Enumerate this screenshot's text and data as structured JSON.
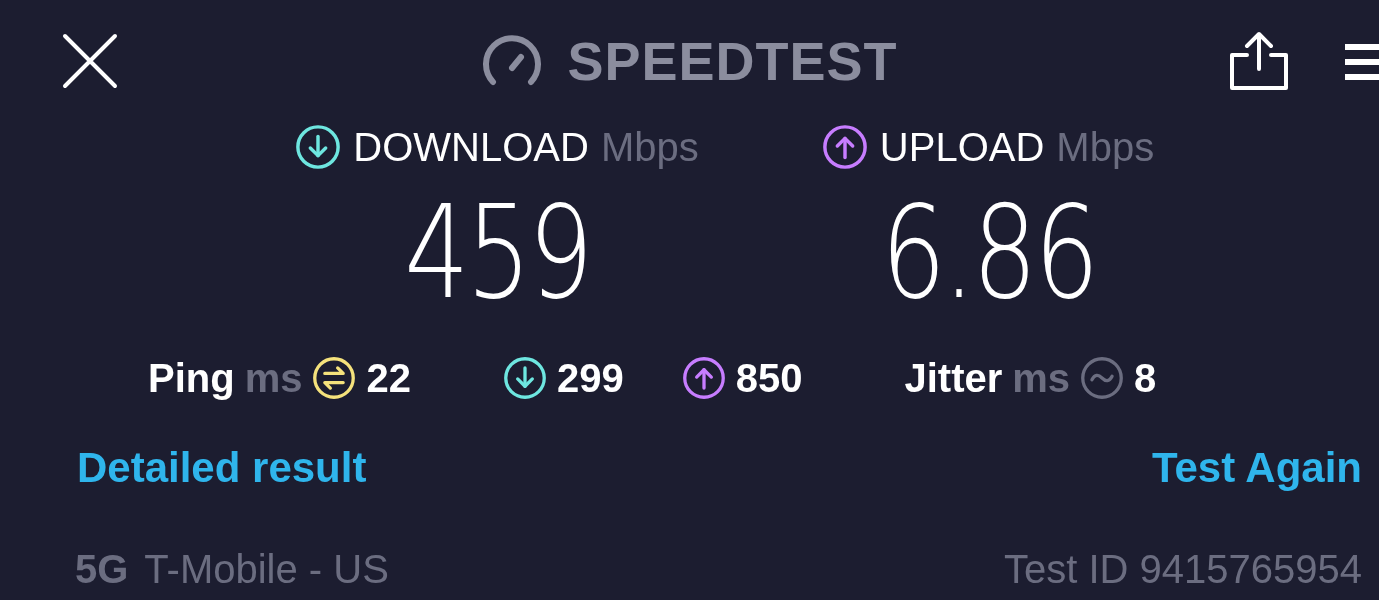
{
  "header": {
    "title": "SPEEDTEST"
  },
  "results": [
    {
      "kind": "download",
      "label": "DOWNLOAD",
      "unit": "Mbps",
      "value": "459",
      "color": "#6ee6e0"
    },
    {
      "kind": "upload",
      "label": "UPLOAD",
      "unit": "Mbps",
      "value": "6.86",
      "color": "#c77dff"
    }
  ],
  "stats": [
    {
      "kind": "ping",
      "label": "Ping",
      "unit": "ms",
      "value": "22",
      "color": "#f5e27c"
    },
    {
      "kind": "download",
      "value": "299",
      "color": "#6ee6e0"
    },
    {
      "kind": "upload",
      "value": "850",
      "color": "#c77dff"
    },
    {
      "kind": "jitter",
      "label": "Jitter",
      "unit": "ms",
      "value": "8",
      "color": "#6b6d80"
    }
  ],
  "links": [
    "Detailed result",
    "Test Again"
  ],
  "footer": {
    "network_type": "5G",
    "carrier": "T-Mobile - US",
    "test_id": "Test ID 9415765954"
  }
}
